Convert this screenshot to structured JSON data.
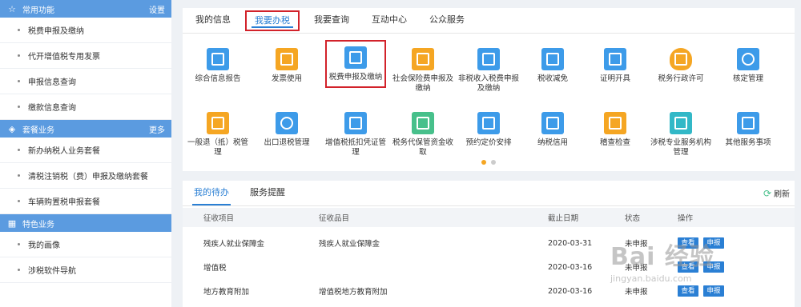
{
  "sidebar": {
    "sections": [
      {
        "icon": "star-icon",
        "title": "常用功能",
        "link": "设置",
        "items": [
          "税费申报及缴纳",
          "代开增值税专用发票",
          "申报信息查询",
          "缴款信息查询"
        ]
      },
      {
        "icon": "layers-icon",
        "title": "套餐业务",
        "link": "更多",
        "items": [
          "新办纳税人业务套餐",
          "清税注销税（费）申报及缴纳套餐",
          "车辆购置税申报套餐"
        ]
      },
      {
        "icon": "grid-icon",
        "title": "特色业务",
        "link": "",
        "items": [
          "我的画像",
          "涉税软件导航"
        ]
      }
    ]
  },
  "top_tabs": [
    "我的信息",
    "我要办税",
    "我要查询",
    "互动中心",
    "公众服务"
  ],
  "services": [
    {
      "label": "综合信息报告",
      "icon": "report-icon",
      "color": "#3d9be9"
    },
    {
      "label": "发票使用",
      "icon": "invoice-icon",
      "color": "#f5a623"
    },
    {
      "label": "税费申报及缴纳",
      "icon": "card-icon",
      "color": "#3d9be9"
    },
    {
      "label": "社会保险费申报及缴纳",
      "icon": "calendar-icon",
      "color": "#f5a623"
    },
    {
      "label": "非税收入税费申报及缴纳",
      "icon": "layout-icon",
      "color": "#3d9be9"
    },
    {
      "label": "税收减免",
      "icon": "document-icon",
      "color": "#3d9be9"
    },
    {
      "label": "证明开具",
      "icon": "certificate-icon",
      "color": "#3d9be9"
    },
    {
      "label": "税务行政许可",
      "icon": "shield-icon",
      "color": "#f5a623"
    },
    {
      "label": "核定管理",
      "icon": "pie-chart-icon",
      "color": "#3d9be9"
    },
    {
      "label": "一般退（抵）税管理",
      "icon": "refund-icon",
      "color": "#f5a623"
    },
    {
      "label": "出口退税管理",
      "icon": "gear-icon",
      "color": "#3d9be9"
    },
    {
      "label": "增值税抵扣凭证管理",
      "icon": "clipboard-icon",
      "color": "#3d9be9"
    },
    {
      "label": "税务代保管资金收取",
      "icon": "wallet-icon",
      "color": "#47c08b"
    },
    {
      "label": "预约定价安排",
      "icon": "id-card-icon",
      "color": "#3d9be9"
    },
    {
      "label": "纳税信用",
      "icon": "check-icon",
      "color": "#3d9be9"
    },
    {
      "label": "稽查检查",
      "icon": "list-icon",
      "color": "#f5a623"
    },
    {
      "label": "涉税专业服务机构管理",
      "icon": "briefcase-icon",
      "color": "#32b8c7"
    },
    {
      "label": "其他服务事项",
      "icon": "search-doc-icon",
      "color": "#3d9be9"
    }
  ],
  "bottom_tabs": [
    "我的待办",
    "服务提醒"
  ],
  "refresh_label": "刷新",
  "table": {
    "headers": [
      "征收项目",
      "征收品目",
      "截止日期",
      "状态",
      "操作"
    ],
    "rows": [
      {
        "item": "残疾人就业保障金",
        "subitem": "残疾人就业保障金",
        "date": "2020-03-31",
        "status": "未申报"
      },
      {
        "item": "增值税",
        "subitem": "",
        "date": "2020-03-16",
        "status": "未申报"
      },
      {
        "item": "地方教育附加",
        "subitem": "增值税地方教育附加",
        "date": "2020-03-16",
        "status": "未申报"
      }
    ],
    "actions": [
      "查看",
      "申报"
    ]
  },
  "watermark": {
    "main": "Bai 经验",
    "sub": "jingyan.baidu.com"
  }
}
